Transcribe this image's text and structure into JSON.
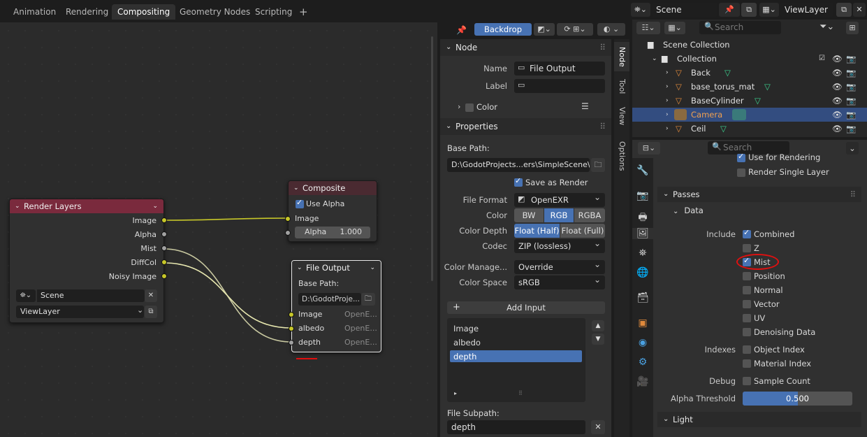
{
  "workspace_tabs": [
    "Animation",
    "Rendering",
    "Compositing",
    "Geometry Nodes",
    "Scripting"
  ],
  "active_tab": "Compositing",
  "add_tab": "+",
  "scene_name": "Scene",
  "viewlayer_name": "ViewLayer",
  "header": {
    "backdrop": "Backdrop"
  },
  "outliner": {
    "search_placeholder": "Search",
    "items": [
      {
        "name": "Scene Collection"
      },
      {
        "name": "Collection"
      },
      {
        "name": "Back"
      },
      {
        "name": "base_torus_mat"
      },
      {
        "name": "BaseCylinder"
      },
      {
        "name": "Camera"
      },
      {
        "name": "Ceil"
      }
    ]
  },
  "nodes": {
    "render_layers": {
      "title": "Render Layers",
      "outputs": [
        "Image",
        "Alpha",
        "Mist",
        "DiffCol",
        "Noisy Image"
      ],
      "scene": "Scene",
      "viewlayer": "ViewLayer"
    },
    "composite": {
      "title": "Composite",
      "use_alpha": "Use Alpha",
      "input_image": "Image",
      "alpha_label": "Alpha",
      "alpha_value": "1.000"
    },
    "file_output": {
      "title": "File Output",
      "base_path_label": "Base Path:",
      "base_path": "D:\\GodotProje...",
      "inputs": [
        {
          "name": "Image",
          "fmt": "OpenE..."
        },
        {
          "name": "albedo",
          "fmt": "OpenE..."
        },
        {
          "name": "depth",
          "fmt": "OpenE..."
        }
      ]
    }
  },
  "sidebar": {
    "tabs": [
      "Node",
      "Tool",
      "View",
      "Options"
    ],
    "node_panel": {
      "title": "Node",
      "name_label": "Name",
      "name_value": "File Output",
      "label_label": "Label",
      "color_label": "Color"
    },
    "properties_panel": {
      "title": "Properties",
      "base_path_label": "Base Path:",
      "base_path": "D:\\GodotProjects...ers\\SimpleScene\\",
      "save_as_render": "Save as Render",
      "file_format_label": "File Format",
      "file_format": "OpenEXR",
      "color_label": "Color",
      "color_options": [
        "BW",
        "RGB",
        "RGBA"
      ],
      "color_selected": "RGB",
      "color_depth_label": "Color Depth",
      "color_depth_options": [
        "Float (Half)",
        "Float (Full)"
      ],
      "codec_label": "Codec",
      "codec": "ZIP (lossless)",
      "color_manage_label": "Color Manage...",
      "color_manage": "Override",
      "color_space_label": "Color Space",
      "color_space": "sRGB",
      "add_input": "Add Input",
      "inputs": [
        "Image",
        "albedo",
        "depth"
      ],
      "selected_input": "depth",
      "file_subpath_label": "File Subpath:",
      "file_subpath": "depth"
    }
  },
  "properties": {
    "search_placeholder": "Search",
    "use_for_rendering": "Use for Rendering",
    "render_single_layer": "Render Single Layer",
    "passes": "Passes",
    "data": "Data",
    "include_label": "Include",
    "include": [
      {
        "name": "Combined",
        "on": true
      },
      {
        "name": "Z",
        "on": false
      },
      {
        "name": "Mist",
        "on": true
      },
      {
        "name": "Position",
        "on": false
      },
      {
        "name": "Normal",
        "on": false
      },
      {
        "name": "Vector",
        "on": false
      },
      {
        "name": "UV",
        "on": false
      },
      {
        "name": "Denoising Data",
        "on": false
      }
    ],
    "indexes_label": "Indexes",
    "indexes": [
      {
        "name": "Object Index"
      },
      {
        "name": "Material Index"
      }
    ],
    "debug_label": "Debug",
    "sample_count": "Sample Count",
    "alpha_threshold_label": "Alpha Threshold",
    "alpha_threshold": "0.500",
    "light": "Light"
  },
  "colors": {
    "accent": "#4772b3",
    "render_layers_header": "#7a2a3d",
    "composite_header": "#4a2a31",
    "socket_yellow": "#c7c729",
    "socket_gray": "#a1a1a1",
    "selection": "#334d80",
    "annotation": "#e01010"
  }
}
